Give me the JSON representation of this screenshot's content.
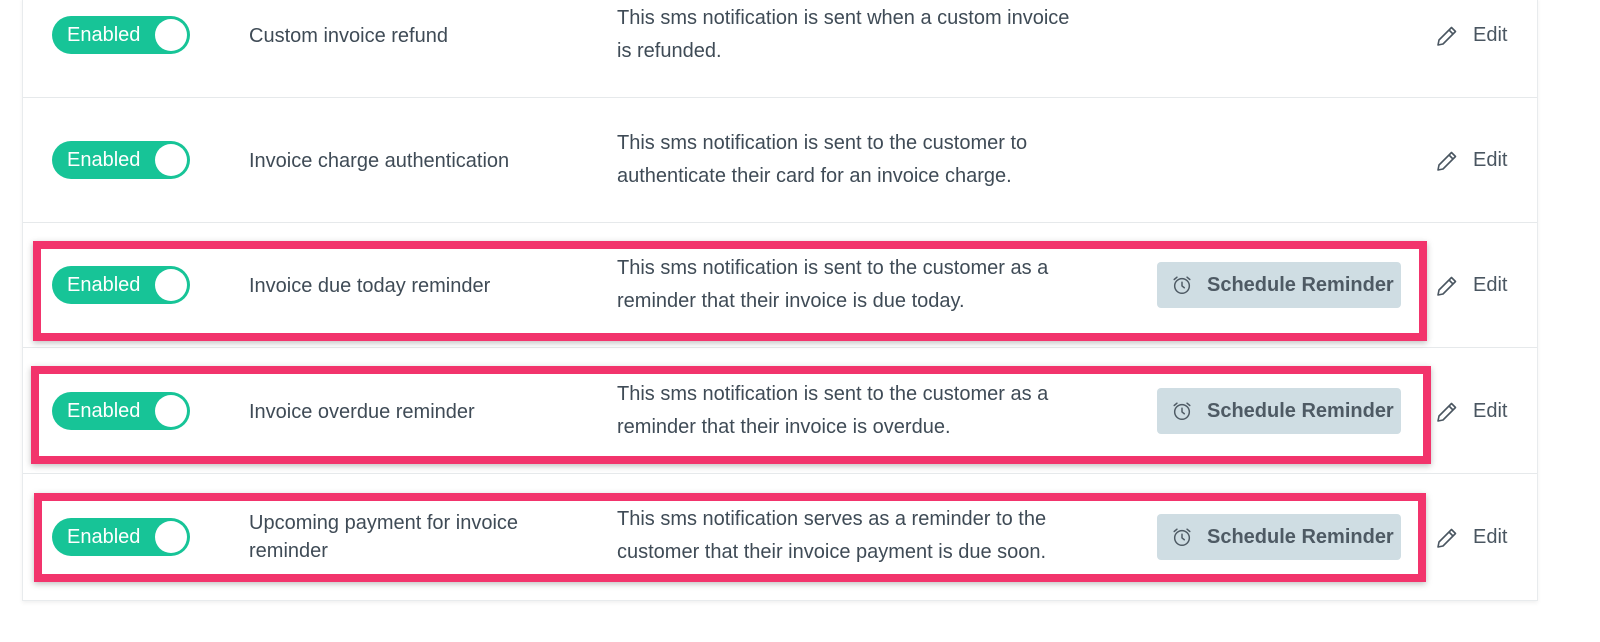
{
  "notifications": [
    {
      "toggle": "Enabled",
      "name": "Custom invoice refund",
      "description": "This sms notification is sent when a custom invoice is refunded.",
      "schedule": null,
      "edit": "Edit"
    },
    {
      "toggle": "Enabled",
      "name": "Invoice charge authentication",
      "description": "This sms notification is sent to the customer to authenticate their card for an invoice charge.",
      "schedule": null,
      "edit": "Edit"
    },
    {
      "toggle": "Enabled",
      "name": "Invoice due today reminder",
      "description": "This sms notification is sent to the customer as a reminder that their invoice is due today.",
      "schedule": "Schedule Reminder",
      "edit": "Edit"
    },
    {
      "toggle": "Enabled",
      "name": "Invoice overdue reminder",
      "description": "This sms notification is sent to the customer as a reminder that their invoice is overdue.",
      "schedule": "Schedule Reminder",
      "edit": "Edit"
    },
    {
      "toggle": "Enabled",
      "name": "Upcoming payment for invoice reminder",
      "description": "This sms notification serves as a reminder to the customer that their invoice payment is due soon.",
      "schedule": "Schedule Reminder",
      "edit": "Edit"
    }
  ],
  "icons": {
    "schedule": "alarm-clock-icon",
    "edit": "pencil-icon"
  },
  "colors": {
    "toggle_on": "#17c497",
    "schedule_button_bg": "#cfdde3",
    "highlight": "#f2346c"
  }
}
